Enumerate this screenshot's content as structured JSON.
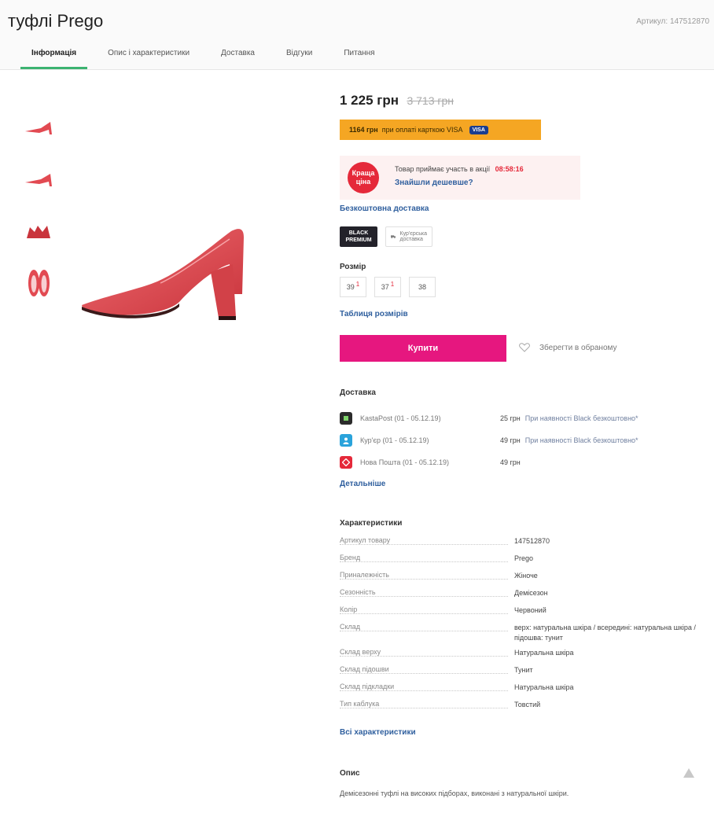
{
  "header": {
    "title": "туфлі Prego",
    "article": "Артикул: 147512870",
    "tabs": [
      {
        "label": "Інформація"
      },
      {
        "label": "Опис і характеристики"
      },
      {
        "label": "Доставка"
      },
      {
        "label": "Відгуки"
      },
      {
        "label": "Питання"
      }
    ]
  },
  "product": {
    "price": "1 225 грн",
    "old_price": "3 713 грн",
    "visa_price": "1164 грн",
    "visa_text": "при оплаті карткою VISA",
    "visa_badge": "VISA",
    "promo_badge": "Краща ціна",
    "promo_text": "Товар приймає участь в акції",
    "promo_timer": "08:58:16",
    "promo_link": "Знайшли дешевше?",
    "free_delivery": "Безкоштовна доставка",
    "black_badge": "BLACK PREMIUM",
    "courier_badge": "Кур'єрська доставка",
    "size_label": "Розмір",
    "sizes": [
      {
        "value": "39",
        "sup": "1"
      },
      {
        "value": "37",
        "sup": "1"
      },
      {
        "value": "38",
        "sup": ""
      }
    ],
    "size_table": "Таблиця розмірів",
    "buy_label": "Купити",
    "wishlist_label": "Зберегти в обраному"
  },
  "delivery": {
    "title": "Доставка",
    "rows": [
      {
        "name": "KastaPost (01 - 05.12.19)",
        "price": "25 грн",
        "note": "При наявності Black безкоштовно*",
        "color": "#2b2b2b"
      },
      {
        "name": "Кур'єр (01 - 05.12.19)",
        "price": "49 грн",
        "note": "При наявності Black безкоштовно*",
        "color": "#2aa3db"
      },
      {
        "name": "Нова Пошта (01 - 05.12.19)",
        "price": "49 грн",
        "note": "",
        "color": "#e5293a"
      }
    ],
    "details": "Детальніше"
  },
  "characteristics": {
    "title": "Характеристики",
    "rows": [
      {
        "key": "Артикул товару",
        "value": "147512870"
      },
      {
        "key": "Бренд",
        "value": "Prego"
      },
      {
        "key": "Приналежність",
        "value": "Жіноче"
      },
      {
        "key": "Сезонність",
        "value": "Демісезон"
      },
      {
        "key": "Колір",
        "value": "Червоний"
      },
      {
        "key": "Склад",
        "value": "верх: натуральна шкіра / всередині: натуральна шкіра / підошва: тунит"
      },
      {
        "key": "Склад верху",
        "value": "Натуральна шкіра"
      },
      {
        "key": "Склад підошви",
        "value": "Тунит"
      },
      {
        "key": "Склад підкладки",
        "value": "Натуральна шкіра"
      },
      {
        "key": "Тип каблука",
        "value": "Товстий"
      }
    ],
    "all": "Всі характеристики"
  },
  "description": {
    "title": "Опис",
    "text": "Демісезонні туфлі на високих підборах, виконані з натуральної шкіри."
  },
  "colors": {
    "accent_green": "#3cb371",
    "buy_pink": "#e6177f",
    "banner_orange": "#f5a623",
    "promo_red": "#e5293a",
    "link_blue": "#2f5f9e",
    "shoe_red": "#e24a52"
  }
}
